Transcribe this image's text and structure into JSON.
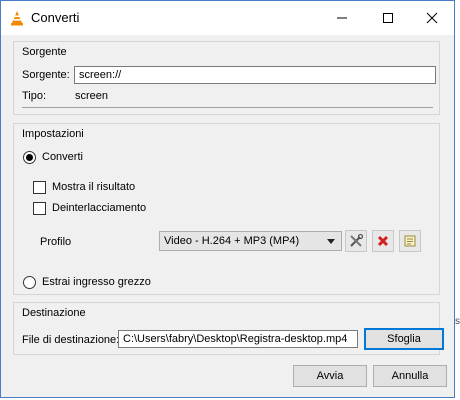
{
  "window": {
    "title": "Converti",
    "icon": "vlc-cone-icon",
    "minimize_glyph": "—",
    "maximize_glyph": "☐",
    "close_glyph": "✕"
  },
  "source_group": {
    "title": "Sorgente",
    "source_label": "Sorgente:",
    "source_value": "screen://",
    "type_label": "Tipo:",
    "type_value": "screen"
  },
  "settings_group": {
    "title": "Impostazioni",
    "convert_option": {
      "label": "Converti",
      "selected": true
    },
    "show_output": {
      "label": "Mostra il risultato",
      "checked": false
    },
    "deinterlace": {
      "label": "Deinterlacciamento",
      "checked": false
    },
    "profile_label": "Profilo",
    "profile_selected": "Video - H.264 + MP3 (MP4)",
    "profile_buttons": [
      "edit-profile-icon",
      "delete-profile-icon",
      "new-profile-icon"
    ],
    "raw_option": {
      "label": "Estrai ingresso grezzo",
      "selected": false
    }
  },
  "destination_group": {
    "title": "Destinazione",
    "file_label": "File di destinazione:",
    "file_value": "C:\\Users\\fabry\\Desktop\\Registra-desktop.mp4",
    "browse_label": "Sfoglia"
  },
  "footer": {
    "start_label": "Avvia",
    "cancel_label": "Annulla"
  },
  "colors": {
    "accent": "#0078d7",
    "delete_red": "#d32020",
    "vlc_orange": "#f08a00"
  },
  "edge_text": "s"
}
